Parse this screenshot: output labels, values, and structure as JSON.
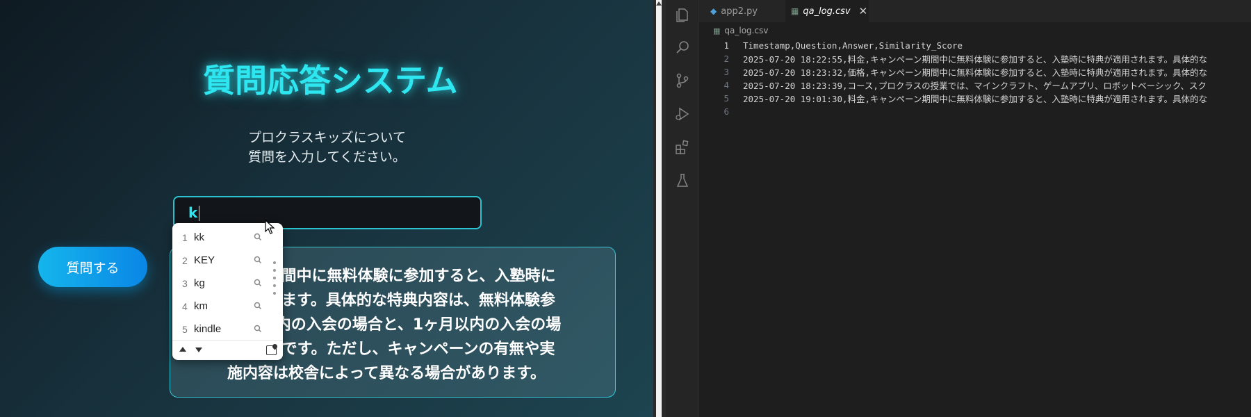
{
  "app": {
    "title": "質問応答システム",
    "subtitle": "プロクラスキッズについて\n質問を入力してください。",
    "input_value": "k",
    "ask_button": "質問する",
    "answer_visible": "期間中に無料体験に参加すると、入塾時に　　　　　　れます。具体的な特典内容は、無料体験参　　　　　　以内の入会の場合と、1ヶ月以内の入会の場　　　　　　うです。ただし、キャンペーンの有無や実施内容は校舎によって異なる場合があります。",
    "answer_lines": [
      "期間中に無料体験に参加すると、入塾時に",
      "れます。具体的な特典内容は、無料体験参",
      "以内の入会の場合と、1ヶ月以内の入会の場",
      "うです。ただし、キャンペーンの有無や実",
      "施内容は校舎によって異なる場合があります。"
    ],
    "colors": {
      "accent": "#2ee6f0",
      "button": "#0a86e6"
    }
  },
  "autocomplete": {
    "items": [
      {
        "num": "1",
        "word": "kk"
      },
      {
        "num": "2",
        "word": "KEY"
      },
      {
        "num": "3",
        "word": "kg"
      },
      {
        "num": "4",
        "word": "km"
      },
      {
        "num": "5",
        "word": "kindle"
      }
    ]
  },
  "vscode": {
    "tabs": [
      {
        "label": "app2.py",
        "icon": "python-icon"
      },
      {
        "label": "qa_log.csv",
        "icon": "csv-icon",
        "active": true
      }
    ],
    "breadcrumb": "qa_log.csv",
    "activity_icons": [
      "explorer-icon",
      "search-icon",
      "source-control-icon",
      "run-debug-icon",
      "extensions-icon",
      "testing-icon"
    ],
    "lines": [
      {
        "n": "1",
        "text": "Timestamp,Question,Answer,Similarity_Score"
      },
      {
        "n": "2",
        "text": "2025-07-20 18:22:55,料金,キャンペーン期間中に無料体験に参加すると、入塾時に特典が適用されます。具体的な"
      },
      {
        "n": "3",
        "text": "2025-07-20 18:23:32,価格,キャンペーン期間中に無料体験に参加すると、入塾時に特典が適用されます。具体的な"
      },
      {
        "n": "4",
        "text": "2025-07-20 18:23:39,コース,プロクラスの授業では、マインクラフト、ゲームアプリ、ロボットベーシック、スク"
      },
      {
        "n": "5",
        "text": "2025-07-20 19:01:30,料金,キャンペーン期間中に無料体験に参加すると、入塾時に特典が適用されます。具体的な"
      },
      {
        "n": "6",
        "text": ""
      }
    ]
  }
}
